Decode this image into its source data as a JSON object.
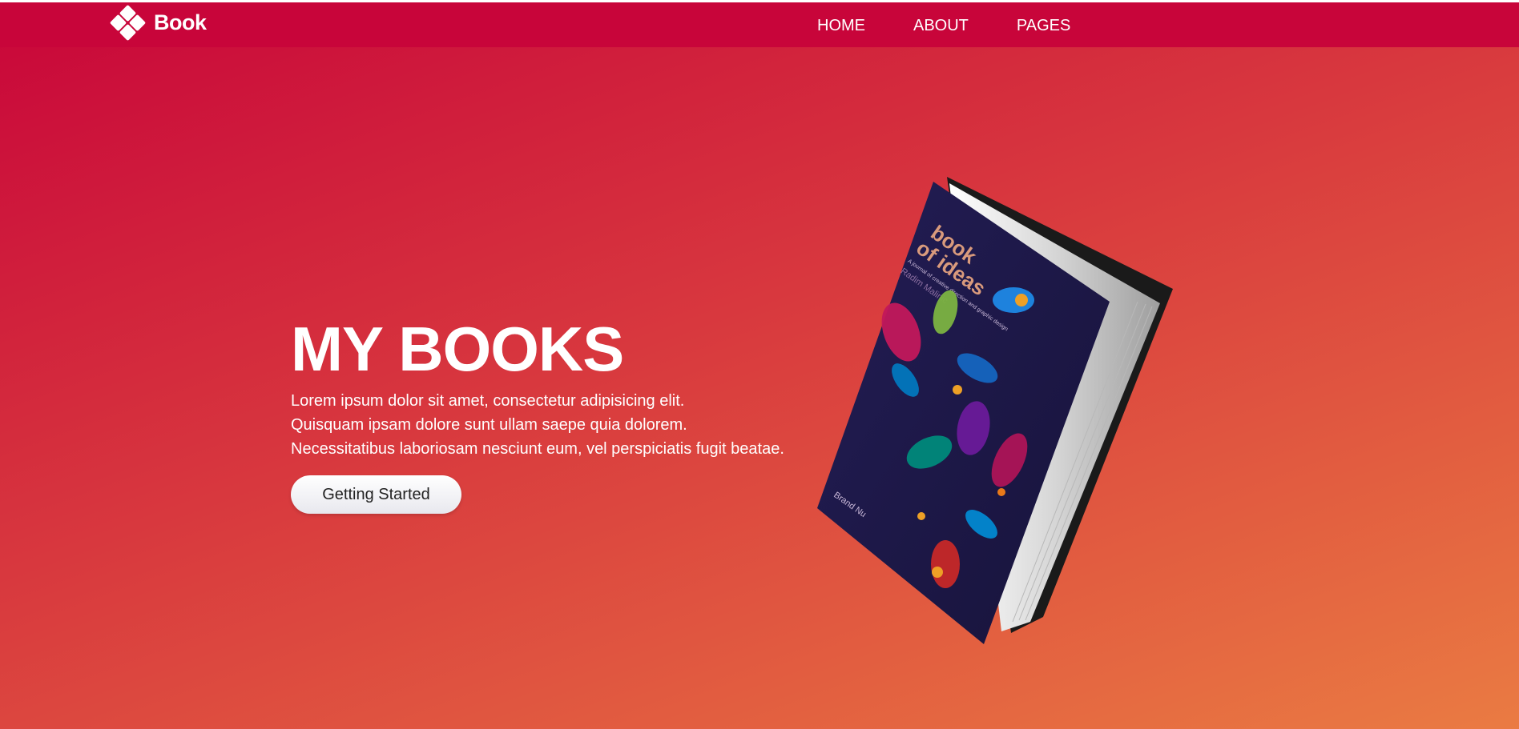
{
  "brand": {
    "name": "Book",
    "icon": "logo-diamond-icon"
  },
  "nav": {
    "home": "HOME",
    "about": "ABOUT",
    "pages": "PAGES"
  },
  "hero": {
    "title": "MY BOOKS",
    "line1": "Lorem ipsum dolor sit amet, consectetur adipisicing elit.",
    "line2": "Quisquam ipsam dolore sunt ullam saepe quia dolorem.",
    "line3": "Necessitatibus laboriosam nesciunt eum, vel perspiciatis fugit beatae.",
    "cta": "Getting Started"
  },
  "book": {
    "title_line1": "book",
    "title_line2": "of ideas",
    "subtitle": "A journal of creative direction and graphic design",
    "author": "Radim Malinic",
    "publisher": "Brand Nu"
  },
  "colors": {
    "nav_bg": "#c8053a",
    "gradient_start": "#c8053a",
    "gradient_end": "#ea7b42",
    "book_cover": "#1f1a4d"
  }
}
